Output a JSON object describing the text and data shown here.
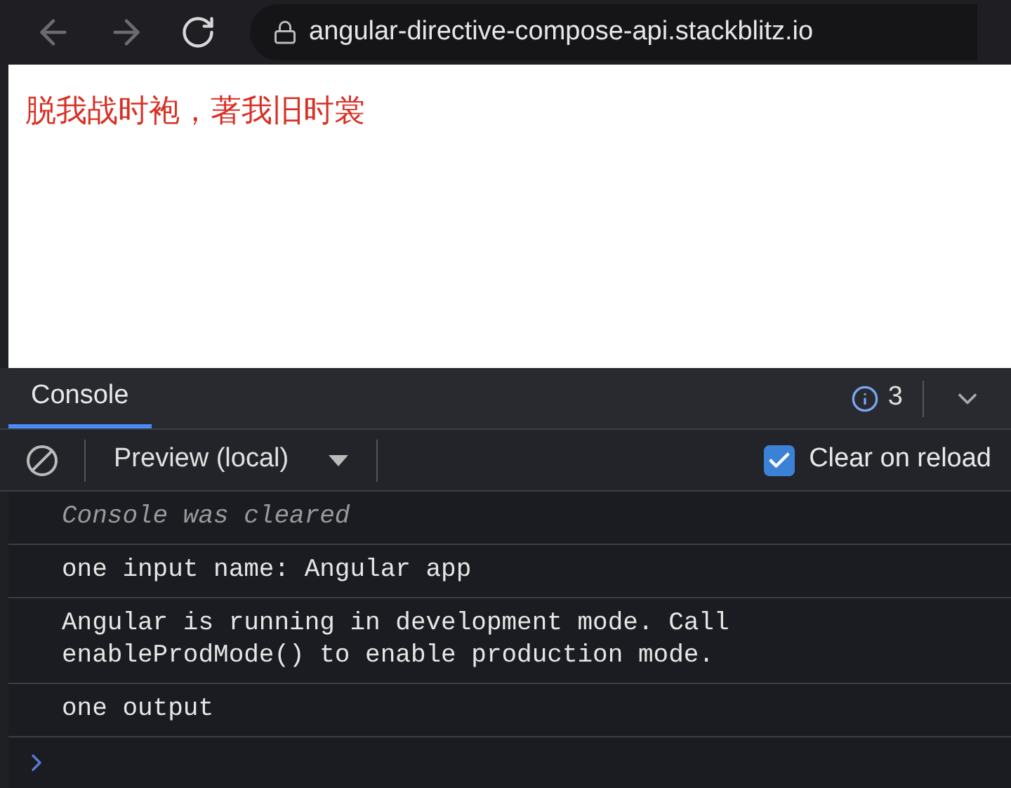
{
  "browser": {
    "url": "angular-directive-compose-api.stackblitz.io"
  },
  "page": {
    "heading": "脱我战时袍，著我旧时裳"
  },
  "devtools": {
    "tabs": [
      {
        "label": "Console",
        "selected": true
      }
    ],
    "info_count": "3",
    "toolbar": {
      "context": "Preview (local)",
      "clear_on_reload": {
        "label": "Clear on reload",
        "checked": true
      }
    },
    "messages": [
      {
        "kind": "info",
        "text": "Console was cleared"
      },
      {
        "kind": "log",
        "text": "one input name: Angular app"
      },
      {
        "kind": "log",
        "text": "Angular is running in development mode. Call enableProdMode() to enable production mode."
      },
      {
        "kind": "log",
        "text": "one output"
      }
    ]
  }
}
